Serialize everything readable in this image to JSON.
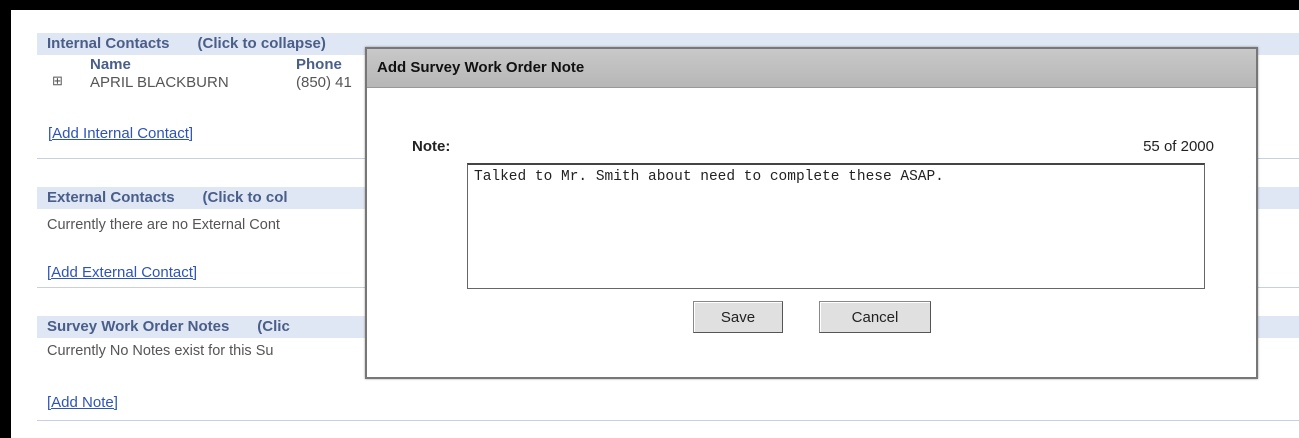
{
  "internal_contacts": {
    "header": "Internal Contacts",
    "toggle": "(Click to collapse)",
    "columns": [
      "Name",
      "Phone"
    ],
    "rows": [
      {
        "expand": "⊞",
        "name": "APRIL BLACKBURN",
        "phone": "(850) 41"
      }
    ],
    "add_link": "[Add Internal Contact]"
  },
  "external_contacts": {
    "header": "External Contacts",
    "toggle": "(Click to col",
    "empty_text": "Currently there are no External Cont",
    "add_link": "[Add External Contact]"
  },
  "notes": {
    "header": "Survey Work Order Notes",
    "toggle": "(Clic",
    "empty_text": "Currently No Notes exist for this Su",
    "add_link": "[Add Note]"
  },
  "modal": {
    "title": "Add Survey Work Order Note",
    "note_label": "Note:",
    "counter": "55 of 2000",
    "note_value": "Talked to Mr. Smith about need to complete these ASAP. ",
    "save_label": "Save",
    "cancel_label": "Cancel"
  }
}
